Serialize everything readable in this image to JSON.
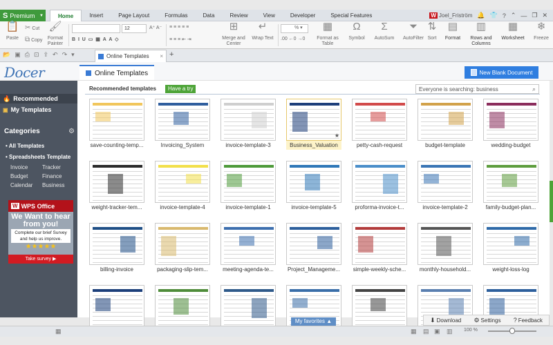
{
  "ribbon_tabs": {
    "premium_label": "Premium",
    "tabs": [
      "Home",
      "Insert",
      "Page Layout",
      "Formulas",
      "Data",
      "Review",
      "View",
      "Developer",
      "Special Features"
    ],
    "user_name": "Joel_Friström"
  },
  "ribbon": {
    "paste": "Paste",
    "cut": "Cut",
    "copy": "Copy",
    "format_painter": "Format Painter",
    "font_size": "12",
    "merge_center": "Merge and Center",
    "wrap_text": "Wrap Text",
    "format_as_table": "Format as Table",
    "symbol": "Symbol",
    "autosum": "AutoSum",
    "autofilter": "AutoFilter",
    "sort": "Sort",
    "format": "Format",
    "rows_columns": "Rows and Columns",
    "worksheet": "Worksheet",
    "freeze": "Freeze"
  },
  "doc_tab": {
    "label": "Online Templates"
  },
  "header": {
    "logo_text": "Docer",
    "tab_label": "Online Templates",
    "new_blank_label": "New Blank Document"
  },
  "sidebar": {
    "recommended": "Recommended",
    "my_templates": "My Templates",
    "categories_title": "Categories",
    "all_templates": "All Templates",
    "spreadsheets_template": "Spreadsheets Template",
    "sub_categories": [
      "Invoice",
      "Tracker",
      "Budget",
      "Finance",
      "Calendar",
      "Business"
    ],
    "ad": {
      "brand": "WPS Office",
      "headline": "We Want to hear from you!",
      "body": "Complete our brief Survey and help us improve.",
      "stars": "★★★★★",
      "button": "Take survey ▶"
    }
  },
  "content": {
    "recommended_title": "Recommended templates",
    "have_a_try": "Have a try",
    "search_placeholder": "Everyone is searching: business",
    "templates": [
      "save-counting-temp...",
      "Invoicing_System",
      "invoice-template-3",
      "Business_Valuation",
      "petty-cash-request",
      "budget-template",
      "wedding-budget",
      "weight-tracker-tem...",
      "invoice-template-4",
      "invoice-template-1",
      "invoice-template-5",
      "proforma-invoice-t...",
      "invoice-template-2",
      "family-budget-plan...",
      "billing-invoice",
      "packaging-slip-tem...",
      "meeting-agenda-te...",
      "Project_Manageme...",
      "simple-weekly-sche...",
      "monthly-household...",
      "weight-loss-log",
      "",
      "",
      "",
      "",
      "",
      "",
      ""
    ],
    "thumb_texts": {
      "weight_tracker": "Weight Tracker",
      "invoice_heading": "INVOICE",
      "logo": "LOGO"
    },
    "selected_index": 3
  },
  "bottom": {
    "my_favorites": "My favorites ▲",
    "download": "Download",
    "settings": "Settings",
    "feedback": "Feedback",
    "zoom": "100 %"
  },
  "colors": {
    "accent_green": "#3f9a3c",
    "accent_blue": "#2f7ee0",
    "sidebar_bg": "#4d5561",
    "selected_card_bg": "#fdf3c9"
  }
}
